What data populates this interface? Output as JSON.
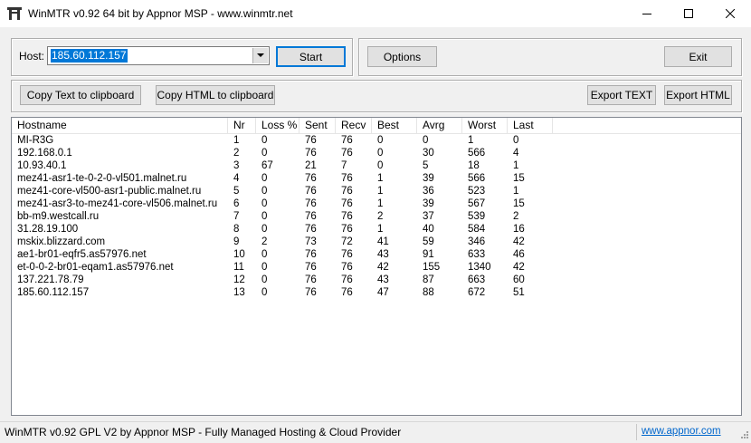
{
  "window": {
    "title": "WinMTR v0.92 64 bit by Appnor MSP - www.winmtr.net",
    "minimize_icon": "minimize-icon",
    "maximize_icon": "maximize-icon",
    "close_icon": "close-icon"
  },
  "host": {
    "label": "Host:",
    "value": "185.60.112.157",
    "start_label": "Start"
  },
  "buttons": {
    "options": "Options",
    "exit": "Exit",
    "copy_text": "Copy Text to clipboard",
    "copy_html": "Copy HTML to clipboard",
    "export_text": "Export TEXT",
    "export_html": "Export HTML"
  },
  "table": {
    "columns": [
      "Hostname",
      "Nr",
      "Loss %",
      "Sent",
      "Recv",
      "Best",
      "Avrg",
      "Worst",
      "Last"
    ],
    "rows": [
      [
        "MI-R3G",
        "1",
        "0",
        "76",
        "76",
        "0",
        "0",
        "1",
        "0"
      ],
      [
        "192.168.0.1",
        "2",
        "0",
        "76",
        "76",
        "0",
        "30",
        "566",
        "4"
      ],
      [
        "10.93.40.1",
        "3",
        "67",
        "21",
        "7",
        "0",
        "5",
        "18",
        "1"
      ],
      [
        "mez41-asr1-te-0-2-0-vl501.malnet.ru",
        "4",
        "0",
        "76",
        "76",
        "1",
        "39",
        "566",
        "15"
      ],
      [
        "mez41-core-vl500-asr1-public.malnet.ru",
        "5",
        "0",
        "76",
        "76",
        "1",
        "36",
        "523",
        "1"
      ],
      [
        "mez41-asr3-to-mez41-core-vl506.malnet.ru",
        "6",
        "0",
        "76",
        "76",
        "1",
        "39",
        "567",
        "15"
      ],
      [
        "bb-m9.westcall.ru",
        "7",
        "0",
        "76",
        "76",
        "2",
        "37",
        "539",
        "2"
      ],
      [
        "31.28.19.100",
        "8",
        "0",
        "76",
        "76",
        "1",
        "40",
        "584",
        "16"
      ],
      [
        "mskix.blizzard.com",
        "9",
        "2",
        "73",
        "72",
        "41",
        "59",
        "346",
        "42"
      ],
      [
        "ae1-br01-eqfr5.as57976.net",
        "10",
        "0",
        "76",
        "76",
        "43",
        "91",
        "633",
        "46"
      ],
      [
        "et-0-0-2-br01-eqam1.as57976.net",
        "11",
        "0",
        "76",
        "76",
        "42",
        "155",
        "1340",
        "42"
      ],
      [
        "137.221.78.79",
        "12",
        "0",
        "76",
        "76",
        "43",
        "87",
        "663",
        "60"
      ],
      [
        "185.60.112.157",
        "13",
        "0",
        "76",
        "76",
        "47",
        "88",
        "672",
        "51"
      ]
    ]
  },
  "status": {
    "text": "WinMTR v0.92 GPL V2 by Appnor MSP - Fully Managed Hosting & Cloud Provider",
    "link": "www.appnor.com"
  },
  "colors": {
    "accent": "#0078d7",
    "link": "#0066cc"
  }
}
